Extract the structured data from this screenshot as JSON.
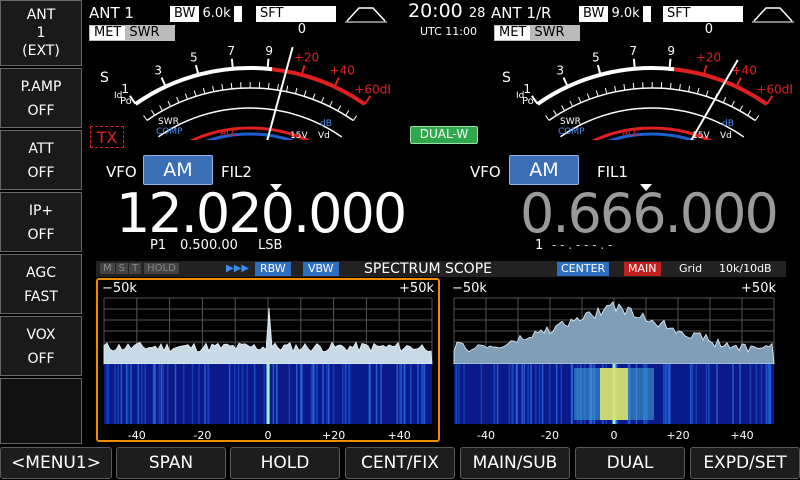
{
  "left_menu": [
    {
      "lines": [
        "ANT",
        "1",
        "(EXT)"
      ]
    },
    {
      "lines": [
        "P.AMP",
        "OFF"
      ]
    },
    {
      "lines": [
        "ATT",
        "OFF"
      ]
    },
    {
      "lines": [
        "IP+",
        "OFF"
      ]
    },
    {
      "lines": [
        "AGC",
        "FAST"
      ]
    },
    {
      "lines": [
        "VOX",
        "OFF"
      ]
    }
  ],
  "main": {
    "ant": "ANT 1",
    "bw_label": "BW",
    "bw_value": "6.0k",
    "sft_label": "SFT",
    "sft_value": "0",
    "met_label": "MET",
    "met_mode": "SWR",
    "tx_label": "TX",
    "vfo_label": "VFO",
    "mode": "AM",
    "filter": "FIL2",
    "frequency": "12.020.000",
    "memory": "P1",
    "offset": "0.500.00",
    "sideband": "LSB"
  },
  "clock": {
    "time": "20:00",
    "day": "28",
    "utc": "UTC 11:00"
  },
  "sub": {
    "ant": "ANT 1/R",
    "bw_label": "BW",
    "bw_value": "9.0k",
    "sft_label": "SFT",
    "sft_value": "0",
    "met_label": "MET",
    "met_mode": "SWR",
    "dual_label": "DUAL-W",
    "vfo_label": "VFO",
    "mode": "AM",
    "filter": "FIL1",
    "frequency": "0.666.000",
    "memory": "1",
    "memory_blank": "- - . - - - . -"
  },
  "meter": {
    "s_scale": [
      "1",
      "3",
      "5",
      "7",
      "9",
      "+20",
      "+40",
      "+60dB"
    ],
    "s_label": "S",
    "po_label": "Po",
    "id_label": "Id",
    "swr_label": "SWR",
    "comp_label": "COMP",
    "alc_label": "ALC",
    "db_label": "dB",
    "v_label": "15V",
    "vd_label": "Vd"
  },
  "scope": {
    "title": "SPECTRUM SCOPE",
    "flags": [
      "M",
      "S",
      "T",
      "HOLD"
    ],
    "arrows": "▶▶▶",
    "rbw": "RBW",
    "vbw": "VBW",
    "center": "CENTER",
    "main_tag": "MAIN",
    "grid": "Grid",
    "grid_value": "10k/10dB",
    "left_edge": "−50k",
    "right_edge": "+50k",
    "axis": [
      "-40",
      "-20",
      "0",
      "+20",
      "+40"
    ]
  },
  "bottom_menu": [
    "<MENU1>",
    "SPAN",
    "HOLD",
    "CENT/FIX",
    "MAIN/SUB",
    "DUAL",
    "EXPD/SET"
  ],
  "colors": {
    "mode_button": "#3a6fb5",
    "scope_focus": "#f08c00",
    "meter_red": "#e02020",
    "meter_blue": "#1e5fd0",
    "dual_green": "#2ea84a"
  }
}
